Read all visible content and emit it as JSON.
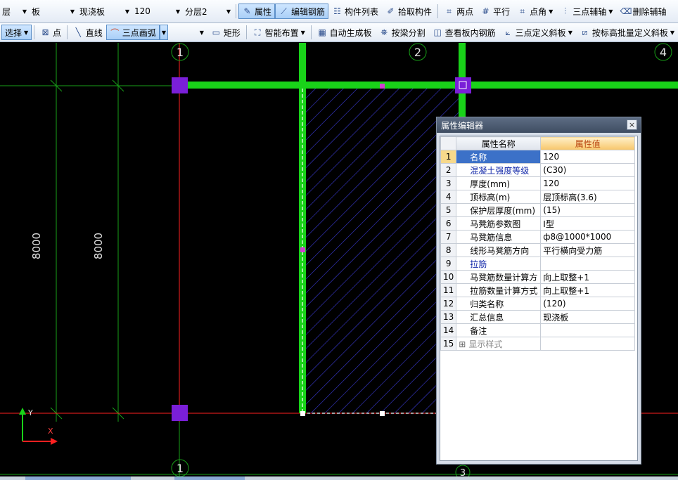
{
  "toolbar1": {
    "floor": "层",
    "type": "板",
    "subtype": "现浇板",
    "thickness": "120",
    "layer": "分层2",
    "properties": "属性",
    "edit_rebar": "编辑钢筋",
    "component_list": "构件列表",
    "pick": "拾取构件",
    "two_points": "两点",
    "parallel": "平行",
    "point_angle": "点角",
    "three_axis": "三点辅轴",
    "delete_axis": "删除辅轴"
  },
  "toolbar2": {
    "select": "选择",
    "point": "点",
    "line": "直线",
    "arc": "三点画弧",
    "rect": "矩形",
    "smart": "智能布置",
    "auto_gen": "自动生成板",
    "split": "按梁分割",
    "view_rebar": "查看板内钢筋",
    "three_point_slab": "三点定义斜板",
    "batch_slope": "按标高批量定义斜板"
  },
  "canvas": {
    "axis_labels": [
      "1",
      "2",
      "4",
      "1",
      "3"
    ],
    "dim1": "8000",
    "dim2": "8000",
    "y_label": "Y",
    "x_label": "X"
  },
  "editor": {
    "title": "属性编辑器",
    "close": "×",
    "col_name": "属性名称",
    "col_value": "属性值",
    "rows": [
      {
        "no": "1",
        "name": "名称",
        "value": "120",
        "style": "blue"
      },
      {
        "no": "2",
        "name": "混凝土强度等级",
        "value": "(C30)",
        "style": "blue"
      },
      {
        "no": "3",
        "name": "厚度(mm)",
        "value": "120",
        "style": ""
      },
      {
        "no": "4",
        "name": "顶标高(m)",
        "value": "层顶标高(3.6)",
        "style": ""
      },
      {
        "no": "5",
        "name": "保护层厚度(mm)",
        "value": "(15)",
        "style": ""
      },
      {
        "no": "6",
        "name": "马凳筋参数图",
        "value": "Ⅰ型",
        "style": ""
      },
      {
        "no": "7",
        "name": "马凳筋信息",
        "value": "ф8@1000*1000",
        "style": ""
      },
      {
        "no": "8",
        "name": "线形马凳筋方向",
        "value": "平行横向受力筋",
        "style": ""
      },
      {
        "no": "9",
        "name": "拉筋",
        "value": "",
        "style": "blue"
      },
      {
        "no": "10",
        "name": "马凳筋数量计算方",
        "value": "向上取整+1",
        "style": ""
      },
      {
        "no": "11",
        "name": "拉筋数量计算方式",
        "value": "向上取整+1",
        "style": ""
      },
      {
        "no": "12",
        "name": "归类名称",
        "value": "(120)",
        "style": ""
      },
      {
        "no": "13",
        "name": "汇总信息",
        "value": "现浇板",
        "style": ""
      },
      {
        "no": "14",
        "name": "备注",
        "value": "",
        "style": ""
      },
      {
        "no": "15",
        "name": "显示样式",
        "value": "",
        "style": "gray"
      }
    ]
  },
  "colors": {
    "beam": "#19d219",
    "axis": "#ff2020",
    "grid": "#18a018",
    "column": "#7a1fd8",
    "hatch": "#3a3ad6"
  }
}
